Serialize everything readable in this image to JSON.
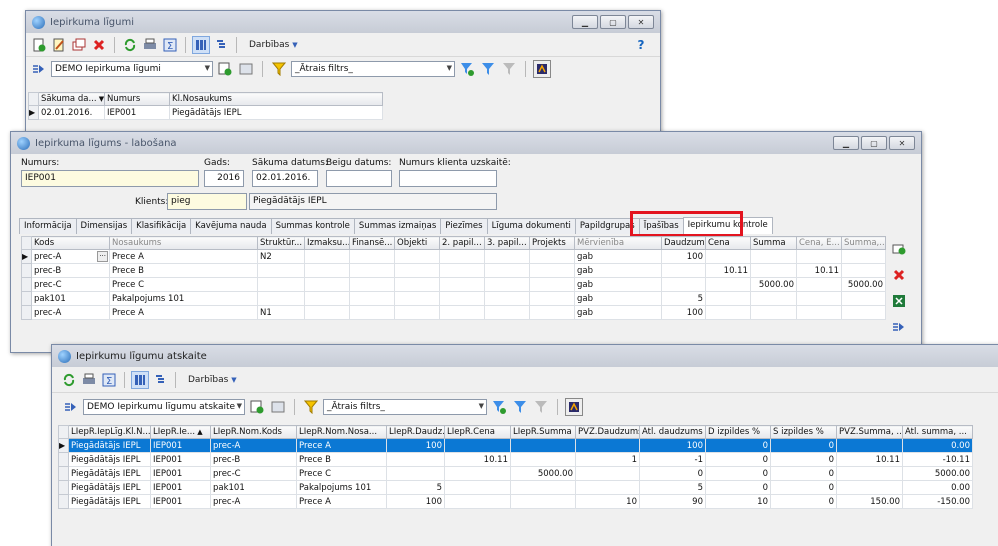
{
  "win1": {
    "title": "Iepirkuma līgumi",
    "menu": "Darbības",
    "dataset": "DEMO Iepirkuma līgumi",
    "filter": "_Ātrais filtrs_",
    "columns": [
      "Sākuma da...",
      "Numurs",
      "Kl.Nosaukums"
    ],
    "rows": [
      [
        "02.01.2016.",
        "IEP001",
        "Piegādātājs IEPL"
      ]
    ]
  },
  "win2": {
    "title": "Iepirkuma līgums - labošana",
    "fields": {
      "numurs_label": "Numurs:",
      "numurs": "IEP001",
      "gads_label": "Gads:",
      "gads": "2016",
      "sakuma_label": "Sākuma datums:",
      "sakuma": "02.01.2016.",
      "beigu_label": "Beigu datums:",
      "beigu": "",
      "nrk_label": "Numurs klienta uzskaitē:",
      "nrk": "",
      "klients_label": "Klients:",
      "klients_code": "pieg",
      "klients_name": "Piegādātājs IEPL"
    },
    "tabs": [
      "Informācija",
      "Dimensijas",
      "Klasifikācija",
      "Kavējuma nauda",
      "Summas kontrole",
      "Summas izmaiņas",
      "Piezīmes",
      "Līguma dokumenti",
      "Papildgrupas",
      "Īpašības",
      "Iepirkumu kontrole"
    ],
    "columns": [
      "Kods",
      "Nosaukums",
      "Struktūr...",
      "Izmaksu...",
      "Finansē...",
      "Objekti",
      "2. papil...",
      "3. papil...",
      "Projekts",
      "Mērvienība",
      "Daudzums",
      "Cena",
      "Summa",
      "Cena, E...",
      "Summa,..."
    ],
    "rows": [
      [
        "prec-A",
        "Prece A",
        "N2",
        "",
        "",
        "",
        "",
        "",
        "",
        "gab",
        "100",
        "",
        "",
        "",
        ""
      ],
      [
        "prec-B",
        "Prece B",
        "",
        "",
        "",
        "",
        "",
        "",
        "",
        "gab",
        "",
        "10.11",
        "",
        "10.11",
        ""
      ],
      [
        "prec-C",
        "Prece C",
        "",
        "",
        "",
        "",
        "",
        "",
        "",
        "gab",
        "",
        "",
        "5000.00",
        "",
        "5000.00"
      ],
      [
        "pak101",
        "Pakalpojums 101",
        "",
        "",
        "",
        "",
        "",
        "",
        "",
        "gab",
        "5",
        "",
        "",
        "",
        ""
      ],
      [
        "prec-A",
        "Prece A",
        "N1",
        "",
        "",
        "",
        "",
        "",
        "",
        "gab",
        "100",
        "",
        "",
        "",
        ""
      ]
    ]
  },
  "win3": {
    "title": "Iepirkumu līgumu atskaite",
    "menu": "Darbības",
    "dataset": "DEMO Iepirkumu līgumu atskaite",
    "filter": "_Ātrais filtrs_",
    "columns": [
      "LIepR.IepLīg.Kl.N...",
      "LIepR.Ie...",
      "LIepR.Nom.Kods",
      "LIepR.Nom.Nosa...",
      "LIepR.Daudz...",
      "LIepR.Cena",
      "LIepR.Summa",
      "PVZ.Daudzums",
      "Atl. daudzums",
      "D izpildes %",
      "S izpildes %",
      "PVZ.Summa, ...",
      "Atl. summa, ..."
    ],
    "rows": [
      [
        "Piegādātājs IEPL",
        "IEP001",
        "prec-A",
        "Prece A",
        "100",
        "",
        "",
        "",
        "100",
        "0",
        "0",
        "",
        "0.00"
      ],
      [
        "Piegādātājs IEPL",
        "IEP001",
        "prec-B",
        "Prece B",
        "",
        "10.11",
        "",
        "1",
        "-1",
        "0",
        "0",
        "10.11",
        "-10.11"
      ],
      [
        "Piegādātājs IEPL",
        "IEP001",
        "prec-C",
        "Prece C",
        "",
        "",
        "5000.00",
        "",
        "0",
        "0",
        "0",
        "",
        "5000.00"
      ],
      [
        "Piegādātājs IEPL",
        "IEP001",
        "pak101",
        "Pakalpojums 101",
        "5",
        "",
        "",
        "",
        "5",
        "0",
        "0",
        "",
        "0.00"
      ],
      [
        "Piegādātājs IEPL",
        "IEP001",
        "prec-A",
        "Prece A",
        "100",
        "",
        "",
        "10",
        "90",
        "10",
        "0",
        "150.00",
        "-150.00"
      ]
    ]
  },
  "colors": {
    "accent": "#0b78d4",
    "highlight": "#e3141f"
  }
}
